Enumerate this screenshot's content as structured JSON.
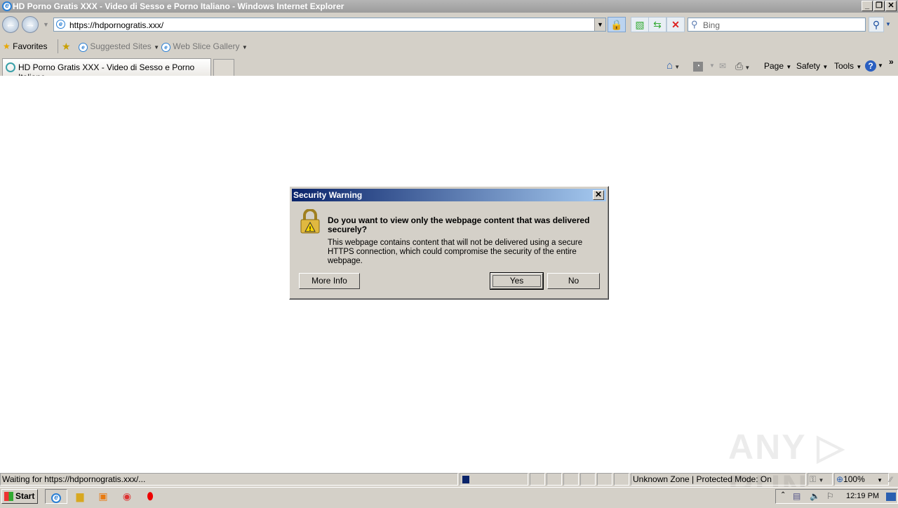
{
  "window": {
    "title": "HD Porno Gratis XXX - Video di Sesso e Porno Italiano - Windows Internet Explorer"
  },
  "address": {
    "url": "https://hdpornogratis.xxx/"
  },
  "search": {
    "placeholder": "Bing"
  },
  "favorites_bar": {
    "favorites": "Favorites",
    "suggested": "Suggested Sites",
    "webslice": "Web Slice Gallery"
  },
  "tab": {
    "label": "HD Porno Gratis XXX - Video di Sesso e Porno Italiano"
  },
  "command_bar": {
    "page": "Page",
    "safety": "Safety",
    "tools": "Tools"
  },
  "dialog": {
    "title": "Security Warning",
    "heading": "Do you want to view only the webpage content that was delivered securely?",
    "body": "This webpage contains content that will not be delivered using a secure HTTPS connection, which could compromise the security of the entire webpage.",
    "more_info": "More Info",
    "yes": "Yes",
    "no": "No"
  },
  "status": {
    "text": "Waiting for https://hdpornogratis.xxx/...",
    "zone": "Unknown Zone | Protected Mode: On",
    "zoom": "100%"
  },
  "taskbar": {
    "start": "Start",
    "clock": "12:19 PM"
  },
  "watermark": "ANY RUN"
}
